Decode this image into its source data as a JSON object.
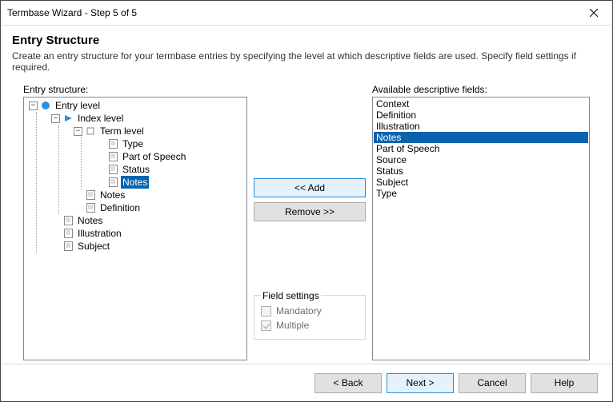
{
  "window": {
    "title": "Termbase Wizard - Step 5 of 5"
  },
  "header": {
    "heading": "Entry Structure",
    "description": "Create an entry structure for your termbase entries by specifying the level at which descriptive fields are used. Specify field settings if required."
  },
  "labels": {
    "entry_structure": "Entry structure:",
    "available_fields": "Available descriptive fields:",
    "field_settings": "Field settings"
  },
  "tree": {
    "entry": "Entry level",
    "index": "Index level",
    "term": "Term level",
    "term_children": {
      "a": "Type",
      "b": "Part of Speech",
      "c": "Status",
      "d": "Notes"
    },
    "index_children": {
      "a": "Notes",
      "b": "Definition"
    },
    "entry_children": {
      "a": "Notes",
      "b": "Illustration",
      "c": "Subject"
    }
  },
  "buttons": {
    "add": "<< Add",
    "remove": "Remove >>"
  },
  "checks": {
    "mandatory": "Mandatory",
    "multiple": "Multiple"
  },
  "available": {
    "items": {
      "0": "Context",
      "1": "Definition",
      "2": "Illustration",
      "3": "Notes",
      "4": "Part of Speech",
      "5": "Source",
      "6": "Status",
      "7": "Subject",
      "8": "Type"
    },
    "selected_index": 3
  },
  "footer": {
    "back": "< Back",
    "next": "Next >",
    "cancel": "Cancel",
    "help": "Help"
  }
}
